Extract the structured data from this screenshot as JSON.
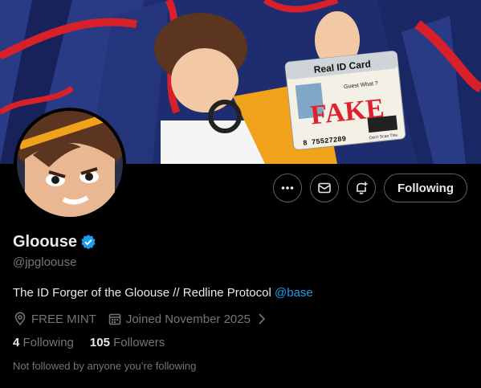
{
  "profile": {
    "display_name": "Gloouse",
    "handle": "@jpgloouse",
    "bio_text": "The ID Forger of the Gloouse // Redline Protocol ",
    "bio_mention": "@base",
    "location": "FREE MINT",
    "joined": "Joined November 2025",
    "following_count": "4",
    "following_label": "Following",
    "followers_count": "105",
    "followers_label": "Followers",
    "note": "Not followed by anyone you’re following"
  },
  "actions": {
    "follow_label": "Following"
  },
  "banner": {
    "card_title": "Real ID Card",
    "card_stamp": "FAKE",
    "card_number": "8 75527289",
    "card_text": "Guest What ?",
    "card_footer": "Don't Scan This"
  },
  "icons": [
    "more-icon",
    "message-icon",
    "notify-icon",
    "location-icon",
    "calendar-icon",
    "verified-icon",
    "chevron-right-icon"
  ],
  "colors": {
    "accent": "#1d9bf0",
    "muted": "#71767b",
    "text": "#e7e9ea",
    "border": "#536471"
  }
}
